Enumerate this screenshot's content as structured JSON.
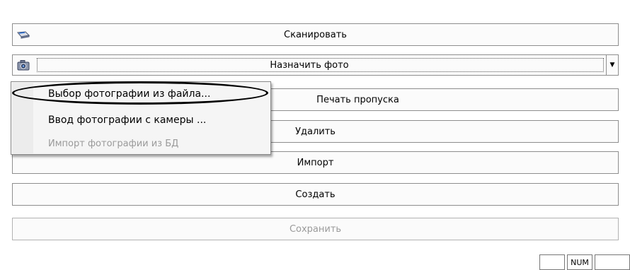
{
  "buttons": {
    "scan": "Сканировать",
    "assign_photo": "Назначить фото",
    "print_pass": "Печать пропуска",
    "delete": "Удалить",
    "import": "Импорт",
    "create": "Создать",
    "save": "Сохранить"
  },
  "menu": {
    "items": [
      {
        "label": "Выбор фотографии из файла...",
        "enabled": true,
        "highlighted": true
      },
      {
        "label": "Ввод фотографии с камеры ...",
        "enabled": true
      },
      {
        "label": "Импорт фотографии из БД",
        "enabled": false
      }
    ]
  },
  "status_bar": {
    "num": "NUM"
  },
  "icons": {
    "scan": "scanner-icon",
    "camera": "camera-icon",
    "dropdown": "chevron-down-icon"
  },
  "colors": {
    "border": "#8e8e8e",
    "button_bg": "#fbfbfb",
    "disabled_text": "#9a9a9a",
    "menu_bg": "#f5f5f5"
  }
}
